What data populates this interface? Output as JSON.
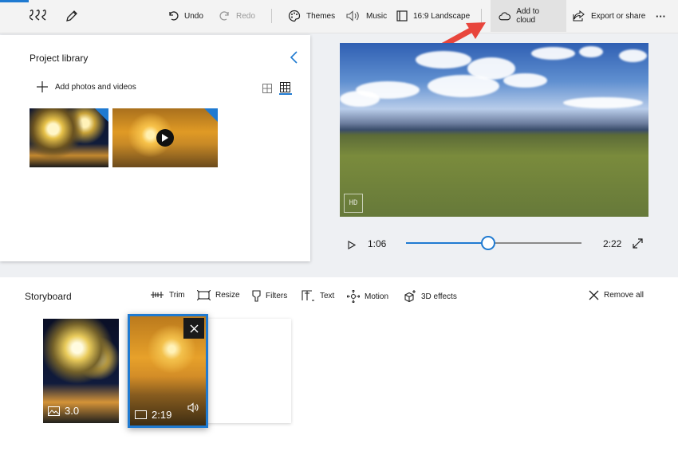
{
  "toolbar": {
    "undo": "Undo",
    "redo": "Redo",
    "themes": "Themes",
    "music": "Music",
    "aspect": "16:9 Landscape",
    "add_to_cloud": "Add to cloud",
    "export": "Export or share",
    "more": "···"
  },
  "library": {
    "title": "Project library",
    "add_label": "Add photos and videos"
  },
  "preview": {
    "watermark": "HD"
  },
  "playback": {
    "current_time": "1:06",
    "total_time": "2:22",
    "progress": 0.466
  },
  "storyboard": {
    "title": "Storyboard",
    "tools": {
      "trim": "Trim",
      "resize": "Resize",
      "filters": "Filters",
      "text": "Text",
      "motion": "Motion",
      "effects3d": "3D effects"
    },
    "remove_all": "Remove all",
    "clips": [
      {
        "duration": "3.0",
        "kind": "image-icon"
      },
      {
        "duration": "2:19",
        "kind": "video-icon"
      }
    ]
  },
  "colors": {
    "accent": "#1f7ad1",
    "arrow": "#e8453c"
  }
}
